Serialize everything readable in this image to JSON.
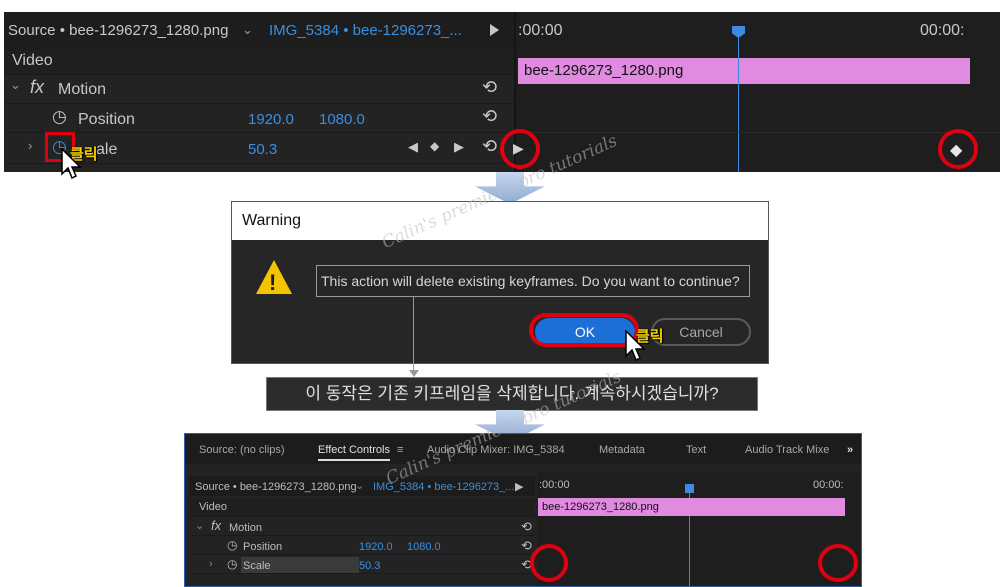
{
  "panel1": {
    "source_label": "Source • bee-1296273_1280.png",
    "clip_label": "IMG_5384 • bee-1296273_...",
    "section": "Video",
    "effect_icon": "fx",
    "effect_name": "Motion",
    "position_label": "Position",
    "position_x": "1920.0",
    "position_y": "1080.0",
    "scale_label": "Scale",
    "scale_value": "50.3",
    "scale_label_obscured": "ale",
    "time_start": ":00:00",
    "time_end": "00:00:",
    "clip_bar": "bee-1296273_1280.png",
    "click_label": "클릭"
  },
  "warning": {
    "title": "Warning",
    "message": "This action will delete existing keyframes. Do you want to continue?",
    "ok": "OK",
    "cancel": "Cancel",
    "click_label": "클릭"
  },
  "translation": "이 동작은 기존 키프레임을 삭제합니다. 계속하시겠습니까?",
  "panel3": {
    "tabs": [
      "Source: (no clips)",
      "Effect Controls",
      "Audio Clip Mixer: IMG_5384",
      "Metadata",
      "Text",
      "Audio Track Mixe"
    ],
    "tab_menu": "≡",
    "overflow": "»",
    "source_label": "Source • bee-1296273_1280.png",
    "clip_label": "IMG_5384 • bee-1296273_...",
    "section": "Video",
    "effect_icon": "fx",
    "effect_name": "Motion",
    "position_label": "Position",
    "position_x": "1920.0",
    "position_y": "1080.0",
    "scale_label": "Scale",
    "scale_value": "50.3",
    "time_start": ":00:00",
    "time_end": "00:00:",
    "clip_bar": "bee-1296273_1280.png"
  },
  "watermark": "Calin's premiere pro tutorials",
  "colors": {
    "accent_blue": "#3a8fe0",
    "clip_pink": "#e08ae0",
    "highlight_red": "#e00010",
    "warning_yellow": "#f5c400"
  }
}
